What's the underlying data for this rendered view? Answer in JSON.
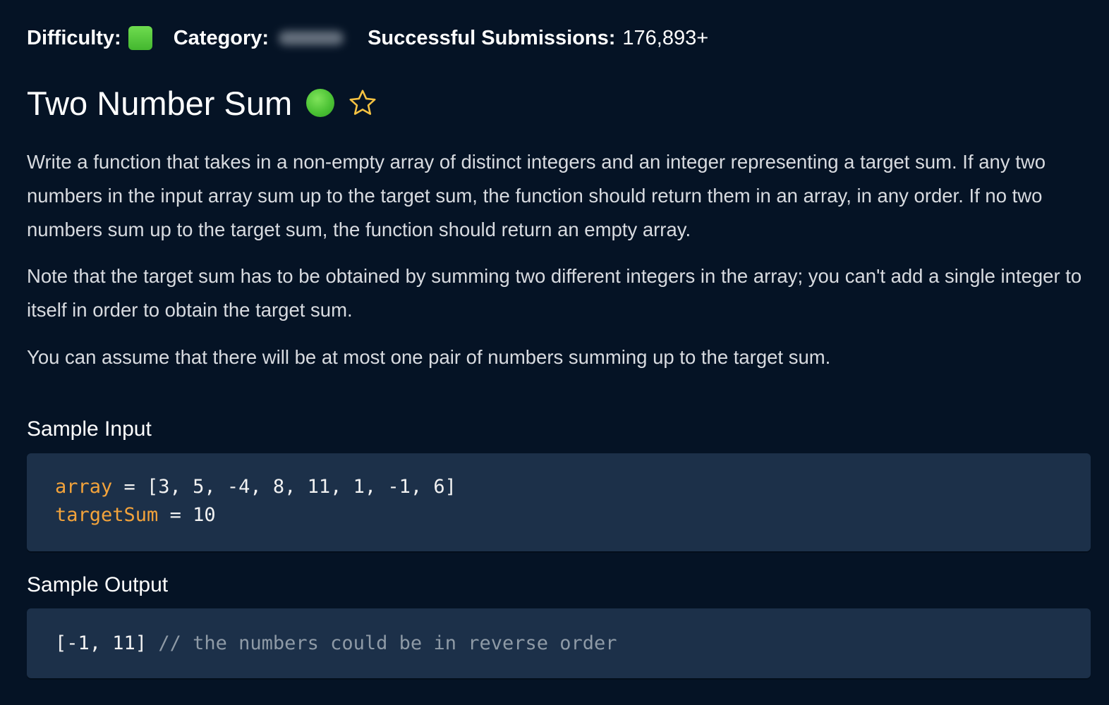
{
  "meta": {
    "difficulty_label": "Difficulty:",
    "difficulty_color": "#52c23a",
    "category_label": "Category:",
    "submissions_label": "Successful Submissions:",
    "submissions_value": "176,893+"
  },
  "problem": {
    "title": "Two Number Sum",
    "status_color": "#4cc235",
    "favorite_icon": "star-outline-icon",
    "paragraphs": [
      "Write a function that takes in a non-empty array of distinct integers and an integer representing a target sum. If any two numbers in the input array sum up to the target sum, the function should return them in an array, in any order. If no two numbers sum up to the target sum, the function should return an empty array.",
      "Note that the target sum has to be obtained by summing two different integers in the array; you can't add a single integer to itself in order to obtain the target sum.",
      "You can assume that there will be at most one pair of numbers summing up to the target sum."
    ]
  },
  "sample_input": {
    "heading": "Sample Input",
    "lines": [
      {
        "name": "array",
        "rest": " = [3, 5, -4, 8, 11, 1, -1, 6]"
      },
      {
        "name": "targetSum",
        "rest": " = 10"
      }
    ]
  },
  "sample_output": {
    "heading": "Sample Output",
    "value": "[-1, 11]",
    "comment": "// the numbers could be in reverse order"
  },
  "colors": {
    "background": "#051325",
    "code_background": "#1c3049",
    "variable": "#f3a33b",
    "comment": "#8e9aa6",
    "star": "#f5c242"
  }
}
